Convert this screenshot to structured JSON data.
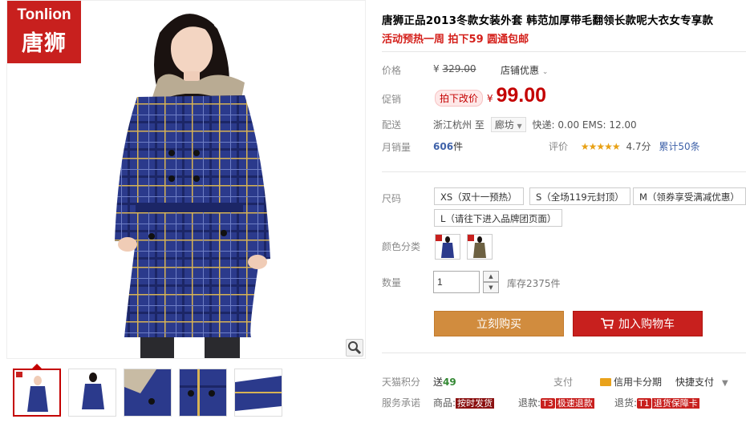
{
  "brand": {
    "en": "Tonlion",
    "cn": "唐狮"
  },
  "product": {
    "title": "唐狮正品2013冬款女装外套 韩范加厚带毛翻领长款呢大衣女专享款",
    "subtitle": "活动预热一周 拍下59 圆通包邮"
  },
  "price": {
    "label": "价格",
    "currency": "¥",
    "original": "329.00",
    "store_promo": "店铺优惠"
  },
  "promo": {
    "label": "促销",
    "tag": "拍下改价",
    "currency": "¥",
    "price": "99.00"
  },
  "shipping": {
    "label": "配送",
    "from": "浙江杭州",
    "to": "至",
    "city": "廊坊",
    "fees": "快递: 0.00 EMS: 12.00"
  },
  "sales": {
    "label": "月销量",
    "count": "606",
    "unit": "件",
    "rating_label": "评价",
    "stars": "★★★★★",
    "score": "4.7分",
    "reviews": "累计50条"
  },
  "sizes": {
    "label": "尺码",
    "options": [
      "XS（双十一预热）",
      "S（全场119元封顶）",
      "M（领券享受满减优惠）",
      "L（请往下进入品牌团页面）"
    ]
  },
  "colors": {
    "label": "颜色分类",
    "swatches": [
      "blue-plaid",
      "olive-plaid"
    ]
  },
  "quantity": {
    "label": "数量",
    "value": "1",
    "stock": "库存2375件",
    "up": "▲",
    "down": "▼"
  },
  "actions": {
    "buy": "立刻购买",
    "cart": "加入购物车"
  },
  "points": {
    "label": "天猫积分",
    "prefix": "送",
    "value": "49"
  },
  "payment": {
    "label": "支付",
    "card": "信用卡分期",
    "quick": "快捷支付",
    "caret": "▼"
  },
  "services": {
    "label": "服务承诺",
    "items": [
      {
        "prefix": "商品:",
        "badge": "按时发货"
      },
      {
        "prefix": "退款:",
        "code": "T3",
        "badge": "极速退款"
      },
      {
        "prefix": "退货:",
        "code": "T1",
        "badge": "退货保障卡"
      }
    ]
  },
  "colors_theme": {
    "accent": "#c8201e",
    "buy": "#d18c3e",
    "link": "#3f62a9",
    "star": "#e8a115",
    "garment": "#2b3a8c"
  }
}
